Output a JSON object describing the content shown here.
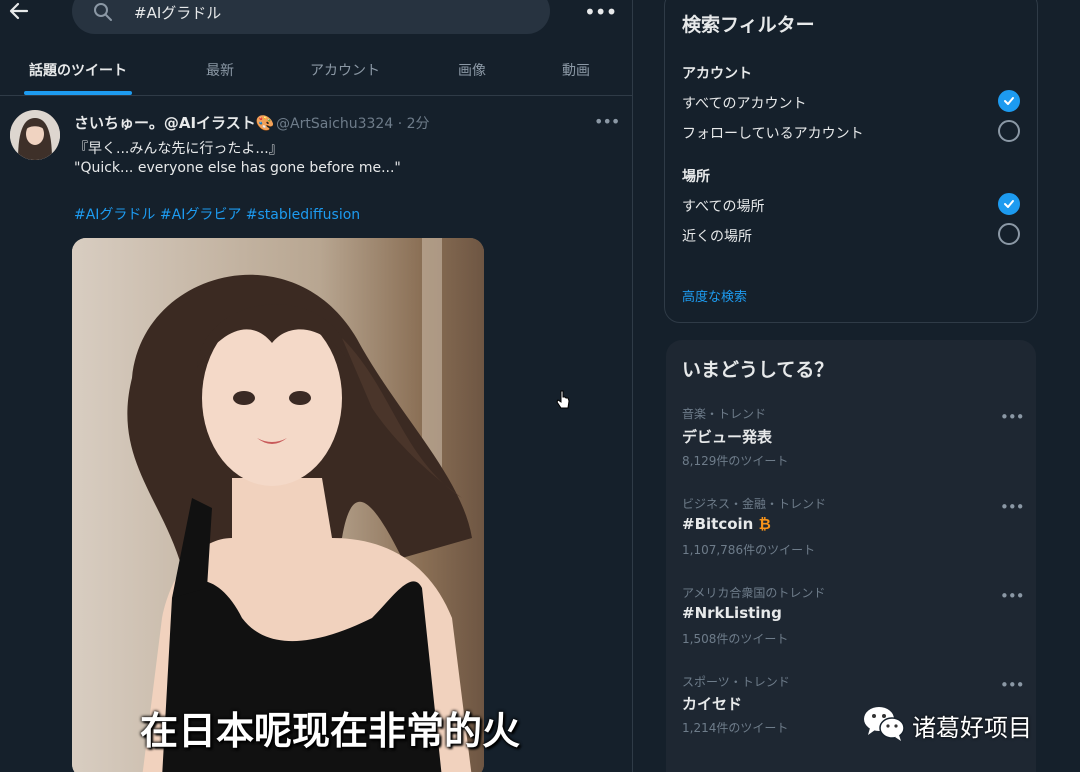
{
  "header": {
    "search_value": "#AIグラドル",
    "more_label": "•••"
  },
  "tabs": [
    {
      "label": "話題のツイート",
      "active": true
    },
    {
      "label": "最新"
    },
    {
      "label": "アカウント"
    },
    {
      "label": "画像"
    },
    {
      "label": "動画"
    }
  ],
  "tweet": {
    "display_name": "さいちゅー。@AIイラスト🎨",
    "meta": "@ArtSaichu3324 · 2分",
    "more_label": "•••",
    "line_jp": "『早く...みんな先に行ったよ...』",
    "line_en": "\"Quick... everyone else has gone before me...\"",
    "hashtags": "#AIグラドル #AIグラビア #stablediffusion"
  },
  "subtitle": "在日本呢现在非常的火",
  "filter": {
    "title": "検索フィルター",
    "account_section": "アカウント",
    "account_all": "すべてのアカウント",
    "account_following": "フォローしているアカウント",
    "location_section": "場所",
    "location_all": "すべての場所",
    "location_near": "近くの場所",
    "advanced_link": "高度な検索"
  },
  "trends": {
    "title": "いまどうしてる？",
    "more_label": "•••",
    "items": [
      {
        "category": "音楽・トレンド",
        "name": "デビュー発表",
        "count": "8,129件のツイート"
      },
      {
        "category": "ビジネス・金融・トレンド",
        "name": "#Bitcoin",
        "count": "1,107,786件のツイート"
      },
      {
        "category": "アメリカ合衆国のトレンド",
        "name": "#NrkListing",
        "count": "1,508件のツイート"
      },
      {
        "category": "スポーツ・トレンド",
        "name": "カイセド",
        "count": "1,214件のツイート"
      }
    ],
    "coin_glyph": "₿"
  },
  "watermark": {
    "text": "诸葛好项目"
  },
  "colors": {
    "background": "#15202b",
    "accent": "#1d9bf0",
    "card": "#1e2732"
  }
}
